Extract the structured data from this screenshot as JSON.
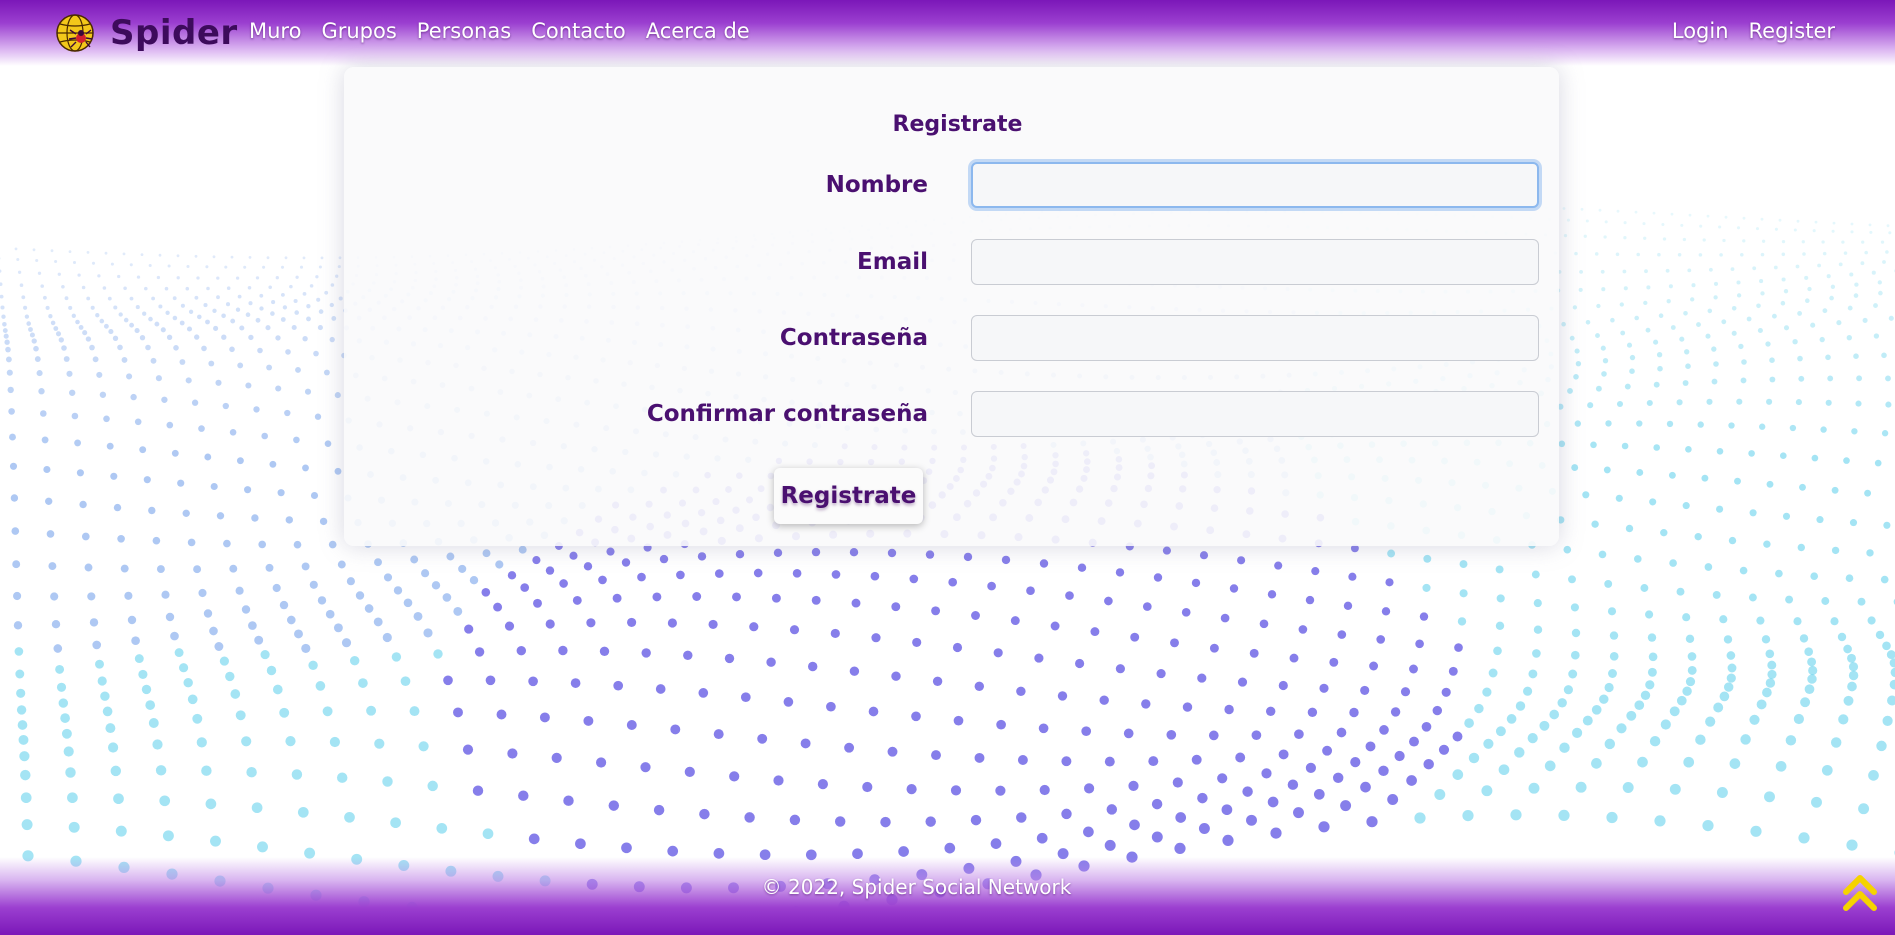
{
  "header": {
    "brand": "Spider",
    "nav": [
      "Muro",
      "Grupos",
      "Personas",
      "Contacto",
      "Acerca de"
    ],
    "auth": [
      "Login",
      "Register"
    ]
  },
  "form": {
    "title": "Registrate",
    "fields": [
      {
        "label": "Nombre",
        "value": "",
        "focused": true
      },
      {
        "label": "Email",
        "value": ""
      },
      {
        "label": "Contraseña",
        "value": ""
      },
      {
        "label": "Confirmar contraseña",
        "value": ""
      }
    ],
    "submit_label": "Registrate"
  },
  "footer": {
    "text": "© 2022, Spider Social Network"
  },
  "icons": {
    "logo": "spider-globe-icon",
    "scroll_top": "double-chevron-up-icon"
  },
  "colors": {
    "header_purple": "#7b17b8",
    "label_purple": "#4a1070",
    "accent_yellow": "#f5d300"
  }
}
